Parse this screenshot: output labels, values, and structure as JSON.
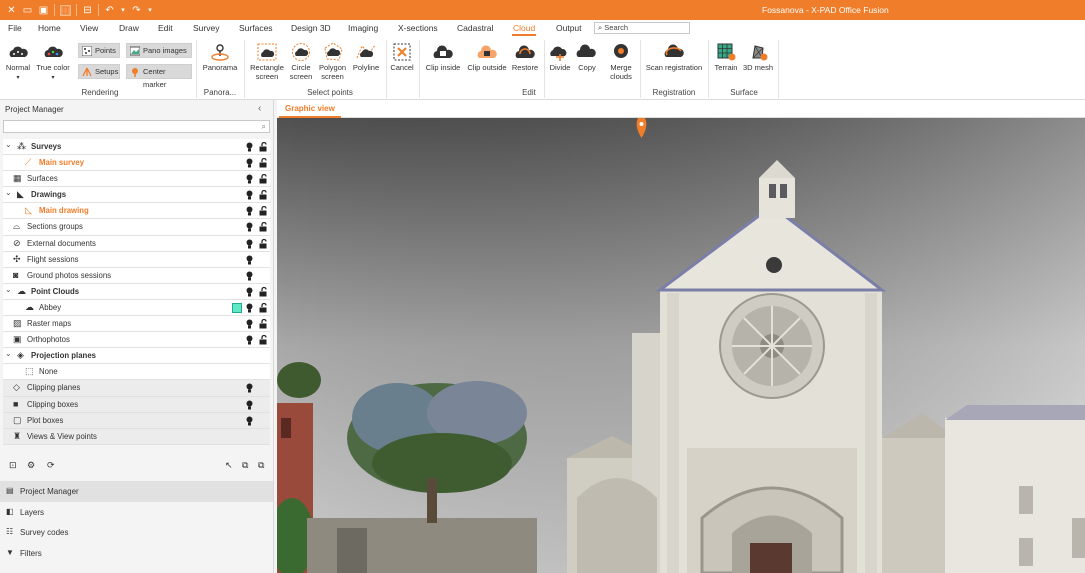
{
  "window": {
    "title": "Fossanova - X-PAD Office Fusion"
  },
  "menu": {
    "tabs": [
      "File",
      "Home",
      "View",
      "Draw",
      "Edit",
      "Survey",
      "Surfaces",
      "Design 3D",
      "Imaging",
      "X-sections",
      "Cadastral",
      "Cloud",
      "Output"
    ],
    "active": "Cloud",
    "search_placeholder": "Search"
  },
  "ribbon": {
    "rendering": {
      "label": "Rendering",
      "normal": "Normal",
      "true_color": "True color",
      "points": "Points",
      "pano_images": "Pano images",
      "setups": "Setups",
      "center_marker": "Center marker"
    },
    "panorama": {
      "label": "Panora...",
      "button": "Panorama"
    },
    "select_points": {
      "label": "Select points",
      "rectangle_1": "Rectangle",
      "rectangle_2": "screen",
      "circle_1": "Circle",
      "circle_2": "screen",
      "polygon_1": "Polygon",
      "polygon_2": "screen",
      "polyline": "Polyline"
    },
    "edit": {
      "label": "Edit",
      "cancel": "Cancel",
      "clip_inside": "Clip inside",
      "clip_outside": "Clip outside",
      "restore": "Restore",
      "divide": "Divide",
      "copy": "Copy",
      "merge_1": "Merge",
      "merge_2": "clouds"
    },
    "registration": {
      "label": "Registration",
      "scan_registration": "Scan registration"
    },
    "surface": {
      "label": "Surface",
      "terrain": "Terrain",
      "mesh": "3D mesh"
    }
  },
  "project_manager": {
    "title": "Project Manager",
    "tree": [
      {
        "label": "Surveys",
        "style": "bold",
        "expander": true,
        "indent": 0,
        "icon": "surveys-icon",
        "bulb": true,
        "lock": true
      },
      {
        "label": "Main survey",
        "style": "orange",
        "expander": false,
        "indent": 1,
        "icon": "survey-icon",
        "bulb": true,
        "lock": true
      },
      {
        "label": "Surfaces",
        "style": "normal",
        "expander": false,
        "indent": 0,
        "icon": "surfaces-icon",
        "bulb": true,
        "lock": true
      },
      {
        "label": "Drawings",
        "style": "bold",
        "expander": true,
        "indent": 0,
        "icon": "drawings-icon",
        "bulb": true,
        "lock": true
      },
      {
        "label": "Main drawing",
        "style": "orange",
        "expander": false,
        "indent": 1,
        "icon": "drawing-icon",
        "bulb": true,
        "lock": true
      },
      {
        "label": "Sections groups",
        "style": "normal",
        "expander": false,
        "indent": 0,
        "icon": "sections-icon",
        "bulb": true,
        "lock": true
      },
      {
        "label": "External documents",
        "style": "normal",
        "expander": false,
        "indent": 0,
        "icon": "attachment-icon",
        "bulb": true,
        "lock": true
      },
      {
        "label": "Flight sessions",
        "style": "normal",
        "expander": false,
        "indent": 0,
        "icon": "drone-icon",
        "bulb": true,
        "lock": false
      },
      {
        "label": "Ground photos sessions",
        "style": "normal",
        "expander": false,
        "indent": 0,
        "icon": "camera-icon",
        "bulb": true,
        "lock": false
      },
      {
        "label": "Point Clouds",
        "style": "bold",
        "expander": true,
        "indent": 0,
        "icon": "cloud-icon",
        "bulb": true,
        "lock": true
      },
      {
        "label": "Abbey",
        "style": "normal",
        "expander": false,
        "indent": 1,
        "icon": "cloud-icon",
        "bulb": true,
        "lock": true,
        "swatch": true
      },
      {
        "label": "Raster maps",
        "style": "normal",
        "expander": false,
        "indent": 0,
        "icon": "raster-icon",
        "bulb": true,
        "lock": true
      },
      {
        "label": "Orthophotos",
        "style": "normal",
        "expander": false,
        "indent": 0,
        "icon": "ortho-icon",
        "bulb": true,
        "lock": true
      },
      {
        "label": "Projection planes",
        "style": "bold",
        "expander": true,
        "indent": 0,
        "icon": "eye-icon",
        "bulb": false,
        "lock": false
      },
      {
        "label": "None",
        "style": "normal",
        "expander": false,
        "indent": 1,
        "icon": "plane-icon",
        "bulb": false,
        "lock": false
      },
      {
        "label": "Clipping planes",
        "style": "normal",
        "grey": true,
        "expander": false,
        "indent": 0,
        "icon": "clip-plane-icon",
        "bulb": true,
        "lock": false
      },
      {
        "label": "Clipping boxes",
        "style": "normal",
        "grey": true,
        "expander": false,
        "indent": 0,
        "icon": "box-icon",
        "bulb": true,
        "lock": false
      },
      {
        "label": "Plot boxes",
        "style": "normal",
        "grey": true,
        "expander": false,
        "indent": 0,
        "icon": "plot-icon",
        "bulb": true,
        "lock": false
      },
      {
        "label": "Views & View points",
        "style": "normal",
        "grey": true,
        "expander": false,
        "indent": 0,
        "icon": "views-icon",
        "bulb": false,
        "lock": false
      }
    ]
  },
  "nav": [
    {
      "label": "Project Manager",
      "active": true,
      "icon": "project-icon"
    },
    {
      "label": "Layers",
      "active": false,
      "icon": "layers-icon"
    },
    {
      "label": "Survey codes",
      "active": false,
      "icon": "codes-icon"
    },
    {
      "label": "Filters",
      "active": false,
      "icon": "filter-icon"
    }
  ],
  "view": {
    "tab": "Graphic view"
  },
  "colors": {
    "accent": "#f07d2a",
    "swatch": "#5ee8c4"
  }
}
